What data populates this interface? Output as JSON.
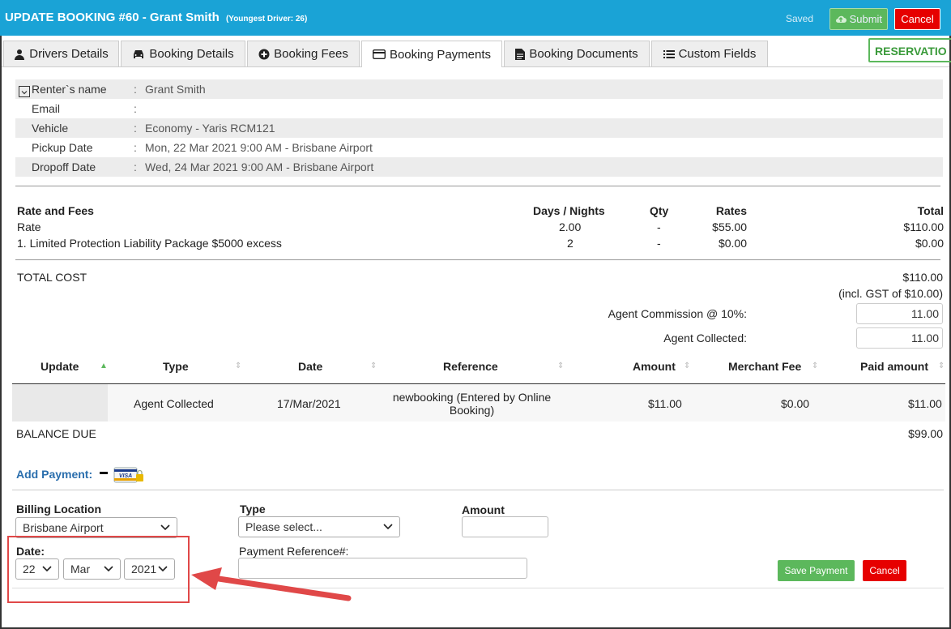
{
  "header": {
    "title": "UPDATE BOOKING #60 - Grant Smith",
    "subtitle": "(Youngest Driver: 26)",
    "saved": "Saved",
    "submit": "Submit",
    "cancel": "Cancel",
    "bg_color": "#1aa3d6"
  },
  "tabs": [
    {
      "label": "Drivers Details",
      "icon": "user-icon"
    },
    {
      "label": "Booking Details",
      "icon": "car-icon"
    },
    {
      "label": "Booking Fees",
      "icon": "plus-circle-icon"
    },
    {
      "label": "Booking Payments",
      "icon": "credit-card-icon"
    },
    {
      "label": "Booking Documents",
      "icon": "document-icon"
    },
    {
      "label": "Custom Fields",
      "icon": "list-icon"
    }
  ],
  "reservation_label": "RESERVATIO",
  "info": [
    {
      "label": "Renter`s name",
      "value": "Grant Smith"
    },
    {
      "label": "Email",
      "value": ""
    },
    {
      "label": "Vehicle",
      "value": "Economy - Yaris RCM121"
    },
    {
      "label": "Pickup Date",
      "value": "Mon, 22 Mar 2021 9:00 AM - Brisbane Airport"
    },
    {
      "label": "Dropoff Date",
      "value": "Wed, 24 Mar 2021 9:00 AM - Brisbane Airport"
    }
  ],
  "fees": {
    "headers": {
      "name": "Rate and Fees",
      "days": "Days / Nights",
      "qty": "Qty",
      "rates": "Rates",
      "total": "Total"
    },
    "rows": [
      {
        "name": "Rate",
        "days": "2.00",
        "qty": "-",
        "rates": "$55.00",
        "total": "$110.00"
      },
      {
        "name": "1. Limited Protection Liability Package $5000 excess",
        "days": "2",
        "qty": "-",
        "rates": "$0.00",
        "total": "$0.00"
      }
    ]
  },
  "totals": {
    "label": "TOTAL COST",
    "value": "$110.00",
    "gst": "(incl. GST of $10.00)",
    "commission_label": "Agent Commission @ 10%:",
    "commission_value": "11.00",
    "collected_label": "Agent Collected:",
    "collected_value": "11.00"
  },
  "payments": {
    "headers": {
      "update": "Update",
      "type": "Type",
      "date": "Date",
      "reference": "Reference",
      "amount": "Amount",
      "fee": "Merchant Fee",
      "paid": "Paid amount"
    },
    "sort_up": "▲",
    "sort_both": "⇕",
    "rows": [
      {
        "type": "Agent Collected",
        "date": "17/Mar/2021",
        "reference_1": "newbooking (Entered by Online",
        "reference_2": "Booking)",
        "amount": "$11.00",
        "fee": "$0.00",
        "paid": "$11.00"
      }
    ]
  },
  "balance": {
    "label": "BALANCE DUE",
    "value": "$99.00"
  },
  "add_payment": {
    "label": "Add Payment:",
    "card_text": "VISA"
  },
  "form": {
    "billing_label": "Billing Location",
    "billing_value": "Brisbane Airport",
    "type_label": "Type",
    "type_value": "Please select...",
    "amount_label": "Amount",
    "date_label": "Date:",
    "day": "22",
    "month": "Mar",
    "year": "2021",
    "ref_label": "Payment Reference#:",
    "save": "Save Payment",
    "cancel": "Cancel"
  }
}
